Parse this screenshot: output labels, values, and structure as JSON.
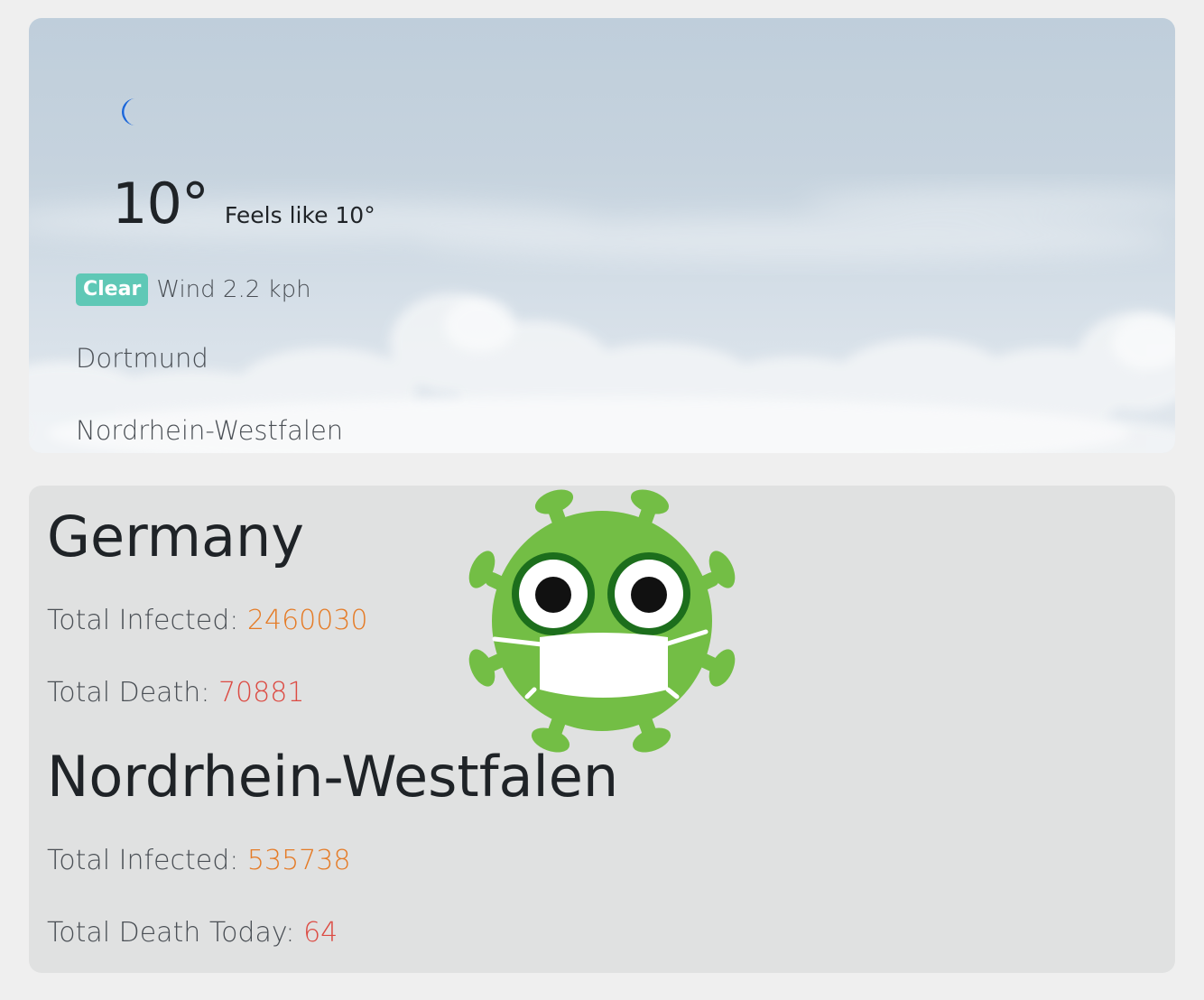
{
  "weather": {
    "icon": "moon-icon",
    "temperature": "10°",
    "feels_like": "Feels like 10°",
    "condition": "Clear",
    "wind": "Wind 2.2 kph",
    "city": "Dortmund",
    "region": "Nordrhein-Westfalen"
  },
  "covid": {
    "mascot_icon": "virus-mascot-icon",
    "country": {
      "name": "Germany",
      "infected_label": "Total Infected: ",
      "infected_value": "2460030",
      "death_label": "Total Death: ",
      "death_value": "70881"
    },
    "region": {
      "name": "Nordrhein-Westfalen",
      "infected_label": "Total Infected: ",
      "infected_value": "535738",
      "death_label": "Total Death Today: ",
      "death_value": "64"
    }
  },
  "colors": {
    "page_bg": "#efefef",
    "badge": "#5fc8b6",
    "infected": "#e57b26",
    "death": "#dc4b43",
    "virus_green": "#73be45"
  }
}
